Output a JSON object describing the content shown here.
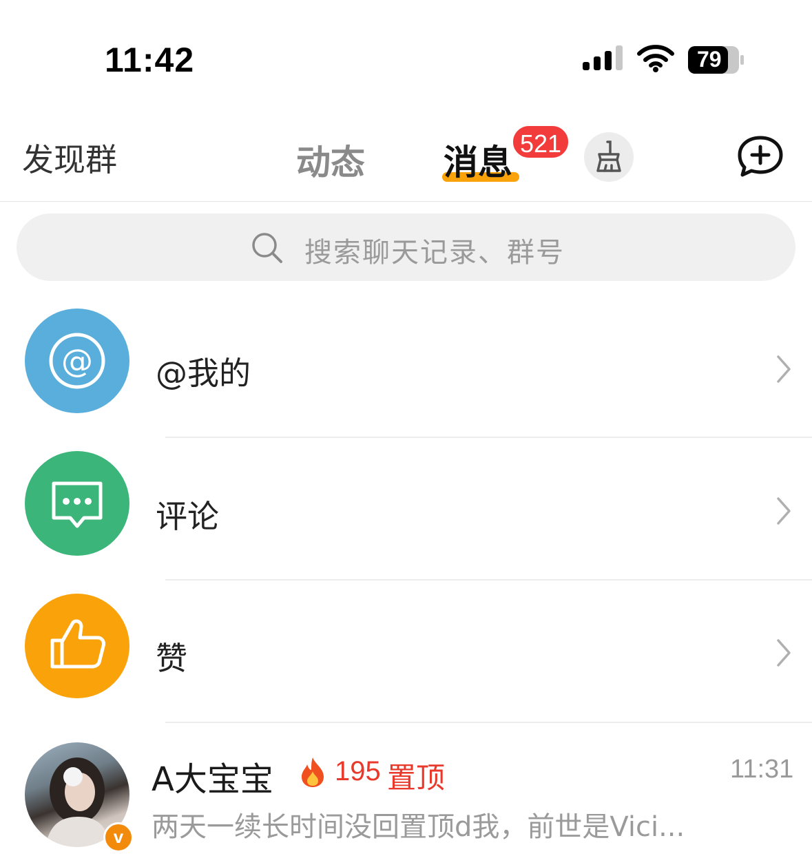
{
  "status_bar": {
    "time": "11:42",
    "battery": "79"
  },
  "header": {
    "tab_discover": "发现群",
    "tab_feed": "动态",
    "tab_messages": "消息",
    "messages_badge": "521"
  },
  "search": {
    "placeholder": "搜索聊天记录、群号"
  },
  "rows": [
    {
      "label": "@我的",
      "icon": "at-icon",
      "color": "#5aaedb"
    },
    {
      "label": "评论",
      "icon": "comment-icon",
      "color": "#3cb57a"
    },
    {
      "label": "赞",
      "icon": "thumbs-up-icon",
      "color": "#f9a20a"
    }
  ],
  "chat": {
    "name": "A大宝宝",
    "streak": "195",
    "pinned_label": "置顶",
    "time": "11:31",
    "preview": "两天一续长时间没回置顶d我，前世是Vici...",
    "verified_badge": "v"
  },
  "colors": {
    "accent": "#f9a20a",
    "badge_red": "#f23c3c",
    "pin_red": "#e8392b"
  }
}
